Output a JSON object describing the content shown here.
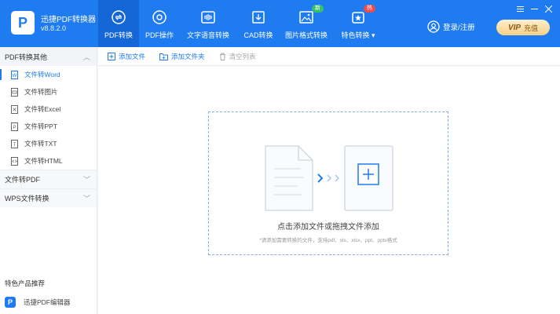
{
  "app": {
    "name": "迅捷PDF转换器",
    "version": "v8.8.2.0",
    "logo_letter": "P"
  },
  "nav": [
    {
      "label": "PDF转换",
      "icon": "pdf-convert-icon",
      "active": true
    },
    {
      "label": "PDF操作",
      "icon": "pdf-operate-icon"
    },
    {
      "label": "文字语音转换",
      "icon": "text-speech-icon"
    },
    {
      "label": "CAD转换",
      "icon": "cad-icon"
    },
    {
      "label": "图片格式转换",
      "icon": "image-format-icon",
      "badge": "新"
    },
    {
      "label": "特色转换",
      "icon": "special-convert-icon",
      "badge": "热"
    }
  ],
  "header": {
    "login_label": "登录/注册",
    "vip_text": "VIP",
    "vip_label": "充值"
  },
  "sidebar": {
    "group1": "PDF转换其他",
    "items": [
      "文件转Word",
      "文件转图片",
      "文件转Excel",
      "文件转PPT",
      "文件转TXT",
      "文件转HTML"
    ],
    "group2": "文件转PDF",
    "group3": "WPS文件转换",
    "recommend_title": "特色产品推荐",
    "recommend_item": "迅捷PDF编辑器"
  },
  "toolbar": {
    "add_file": "添加文件",
    "add_folder": "添加文件夹",
    "clear_list": "清空列表"
  },
  "dropzone": {
    "title": "点击添加文件或拖拽文件添加",
    "hint": "*请添加需要转换的文件，支持pdf、xls、xlsx、ppt、pptx格式"
  },
  "colors": {
    "primary": "#1e7bf0",
    "badge_new": "#36c06b",
    "badge_hot": "#f24b4b"
  }
}
